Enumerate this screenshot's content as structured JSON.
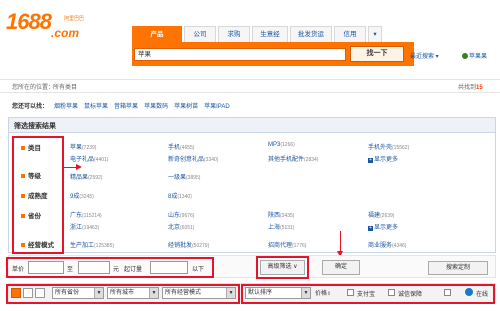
{
  "logo": {
    "num": "1688",
    "com": ".com",
    "tagline": "阿里巴巴"
  },
  "tabs": [
    {
      "label": "产品"
    },
    {
      "label": "公司"
    },
    {
      "label": "求购"
    },
    {
      "label": "生意经"
    },
    {
      "label": "批发货运"
    },
    {
      "label": "信用"
    },
    {
      "label": "▾"
    }
  ],
  "search": {
    "value": "苹果",
    "button": "找一下",
    "recent": "最近搜索 ▾",
    "tagged": "苹果果"
  },
  "location": {
    "label": "您所在的位置：",
    "value": "所有类目",
    "total_label": "共找到",
    "total_value": "15"
  },
  "suggest": {
    "label": "您还可以找：",
    "items": [
      "烟粉苹果",
      "鼠标苹果",
      "音箱苹果",
      "苹果数码",
      "苹果树苗",
      "苹果IPAD"
    ]
  },
  "filter": {
    "title": "筛选搜索结果",
    "categories": [
      "类目",
      "等级",
      "成熟度",
      "省份",
      "经营模式"
    ],
    "rows": {
      "category": [
        {
          "name": "苹果",
          "count": "(7239)"
        },
        {
          "name": "手机",
          "count": "(4655)"
        },
        {
          "name": "MP3",
          "count": "(1266)"
        },
        {
          "name": "手机外壳",
          "count": "(15562)"
        },
        {
          "name": "电子礼品",
          "count": "(4401)"
        },
        {
          "name": "新奇创意礼品",
          "count": "(3340)"
        },
        {
          "name": "其他手机配件",
          "count": "(2834)"
        }
      ],
      "grade": [
        {
          "name": "精品果",
          "count": "(2592)"
        },
        {
          "name": "一级果",
          "count": "(3895)"
        }
      ],
      "maturity": [
        {
          "name": "9成",
          "count": "(3245)"
        },
        {
          "name": "8成",
          "count": "(1340)"
        }
      ],
      "province": [
        {
          "name": "广东",
          "count": "(115214)"
        },
        {
          "name": "山东",
          "count": "(9676)"
        },
        {
          "name": "陕西",
          "count": "(3435)"
        },
        {
          "name": "福建",
          "count": "(2639)"
        },
        {
          "name": "浙江",
          "count": "(19463)"
        },
        {
          "name": "北京",
          "count": "(6051)"
        },
        {
          "name": "上海",
          "count": "(5131)"
        }
      ],
      "mode": [
        {
          "name": "生产加工",
          "count": "(125385)"
        },
        {
          "name": "经销批发",
          "count": "(50279)"
        },
        {
          "name": "招商代理",
          "count": "(1776)"
        },
        {
          "name": "商业服务",
          "count": "(4346)"
        }
      ]
    },
    "more": "显示更多"
  },
  "price": {
    "unit_label": "单价",
    "to": "至",
    "yuan": "元",
    "moq_label": "起订量",
    "below": "以下",
    "advanced": "高级筛选 ∨",
    "ok": "确定",
    "custom": "搜索定制"
  },
  "bottom": {
    "province": "所有省份",
    "city": "所有城市",
    "mode": "所有经营模式",
    "sort": "默认排序",
    "price": "价格",
    "alipay": "支付宝",
    "guarantee": "诚信保障",
    "online": "在线"
  },
  "colors": {
    "accent": "#ff7300",
    "link": "#1a55a5",
    "annotation": "#e8122b"
  }
}
